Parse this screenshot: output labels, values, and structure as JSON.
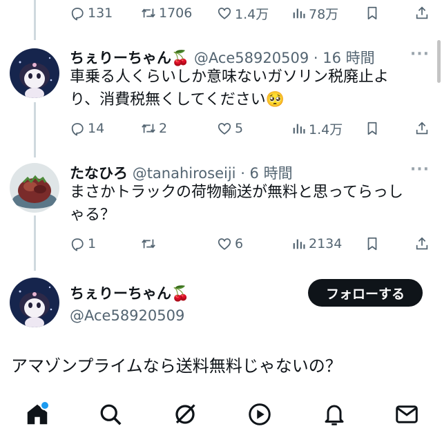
{
  "top_actions": {
    "reply": "131",
    "retweet": "1706",
    "like": "1.4万",
    "views": "78万"
  },
  "tweets": [
    {
      "name": "ちぇりーちゃん🍒",
      "handle": "@Ace58920509",
      "time": "· 16 時間",
      "lines": [
        "車乗る人くらいしか意味ないガソリン税廃止よ",
        "り、消費税無くしてください🥺"
      ],
      "reply": "14",
      "retweet": "2",
      "like": "5",
      "views": "1.4万"
    },
    {
      "name": "たなひろ",
      "handle": "@tanahiroseiji",
      "time": "· 6 時間",
      "lines": [
        "まさかトラックの荷物輸送が無料と思ってらっし",
        "ゃる？"
      ],
      "reply": "1",
      "retweet": "",
      "like": "6",
      "views": "2134"
    }
  ],
  "focused": {
    "name": "ちぇりーちゃん🍒",
    "handle": "@Ace58920509",
    "follow_label": "フォローする",
    "text": "アマゾンプライムなら送料無料じゃないの？"
  },
  "more_glyph": "···",
  "icons": [
    "reply-icon",
    "retweet-icon",
    "like-icon",
    "views-icon",
    "bookmark-icon",
    "share-icon",
    "home-icon",
    "search-icon",
    "grok-icon",
    "play-icon",
    "notifications-icon",
    "messages-icon"
  ],
  "colors": {
    "text": "#0f1419",
    "secondary": "#536471",
    "accent": "#1d9bf0",
    "thread": "#cfd9de"
  }
}
